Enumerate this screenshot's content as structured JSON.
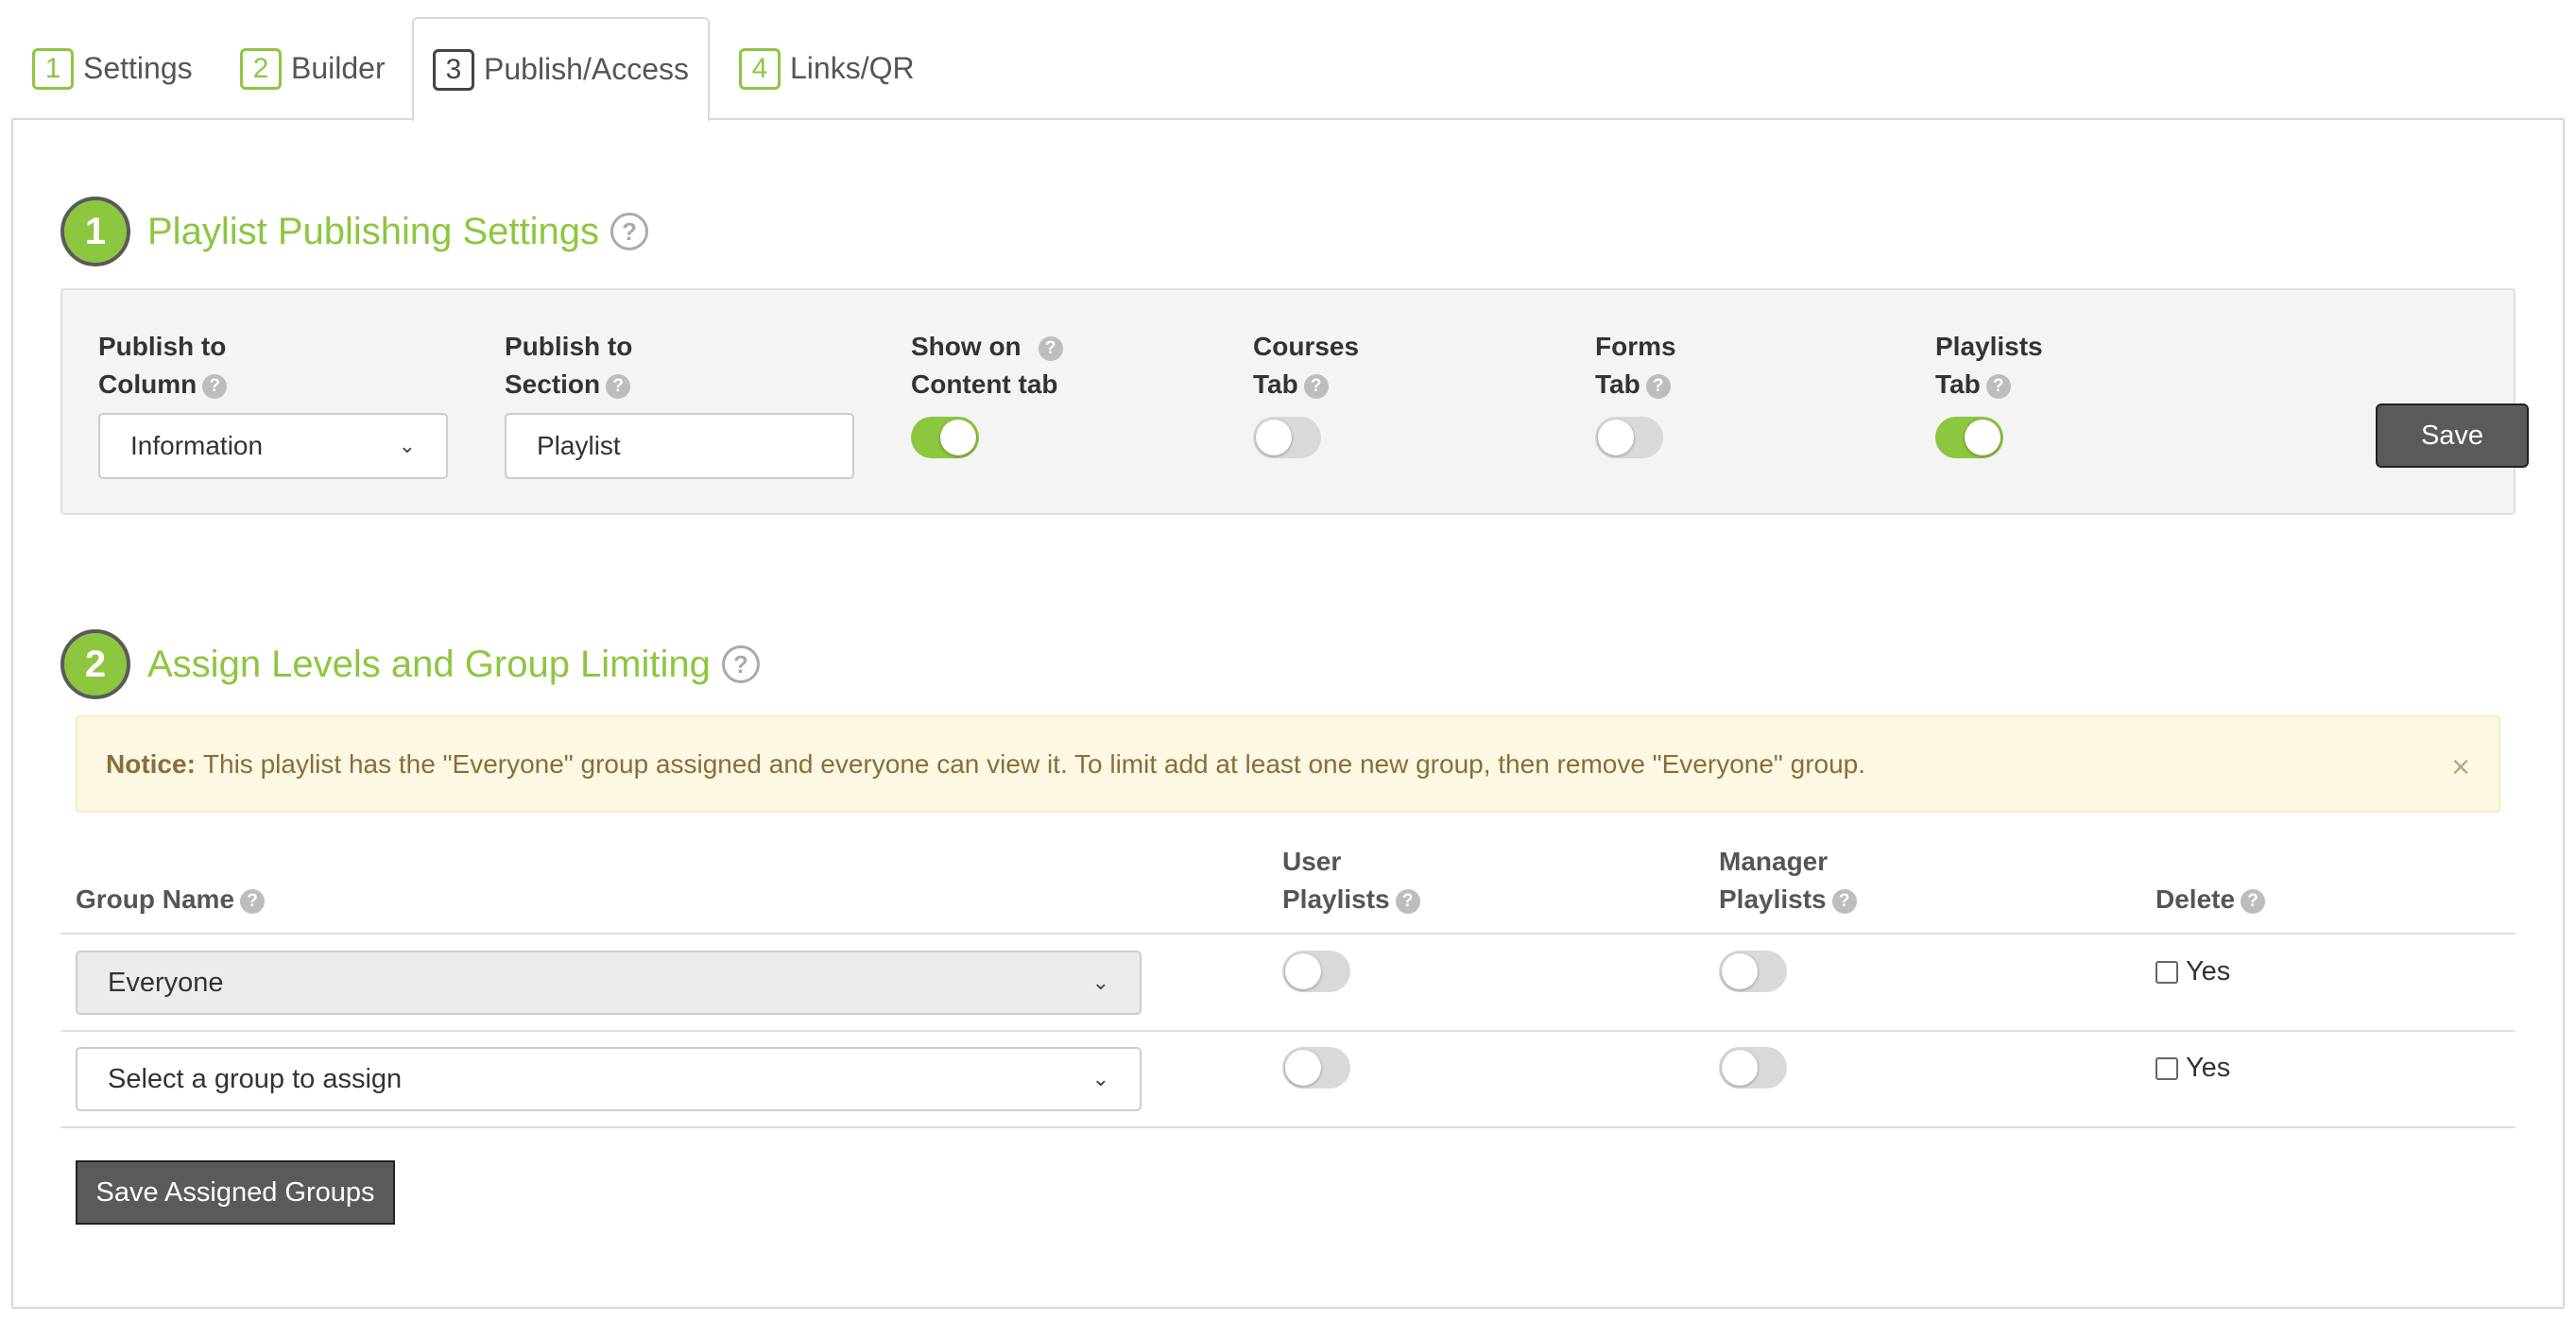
{
  "tabs": [
    {
      "num": "1",
      "label": "Settings"
    },
    {
      "num": "2",
      "label": "Builder"
    },
    {
      "num": "3",
      "label": "Publish/Access",
      "active": true
    },
    {
      "num": "4",
      "label": "Links/QR"
    }
  ],
  "section1": {
    "num": "1",
    "title": "Playlist Publishing Settings",
    "fields": {
      "publish_column": {
        "label_line1": "Publish to",
        "label_line2": "Column",
        "value": "Information"
      },
      "publish_section": {
        "label_line1": "Publish to",
        "label_line2": "Section",
        "value": "Playlist"
      },
      "show_content": {
        "label_line1": "Show on",
        "label_line2": "Content tab",
        "on": true
      },
      "courses_tab": {
        "label_line1": "Courses",
        "label_line2": "Tab",
        "on": false
      },
      "forms_tab": {
        "label_line1": "Forms",
        "label_line2": "Tab",
        "on": false
      },
      "playlists_tab": {
        "label_line1": "Playlists",
        "label_line2": "Tab",
        "on": true
      }
    },
    "save_label": "Save"
  },
  "section2": {
    "num": "2",
    "title": "Assign Levels and Group Limiting",
    "notice": {
      "strong": "Notice:",
      "text": "This playlist has the \"Everyone\" group assigned and everyone can view it. To limit add at least one new group, then remove \"Everyone\" group.",
      "close": "×"
    },
    "columns": {
      "group_name": "Group Name",
      "user_line1": "User",
      "user_line2": "Playlists",
      "manager_line1": "Manager",
      "manager_line2": "Playlists",
      "delete": "Delete"
    },
    "rows": [
      {
        "group": "Everyone",
        "user_on": false,
        "manager_on": false,
        "delete_label": "Yes"
      },
      {
        "group": "Select a group to assign",
        "user_on": false,
        "manager_on": false,
        "delete_label": "Yes"
      }
    ],
    "save_groups_label": "Save Assigned Groups"
  },
  "colors": {
    "accent": "#8dc63f",
    "button": "#5a5a5a",
    "notice_bg": "#fcf8e3",
    "notice_text": "#8a6d3b"
  }
}
